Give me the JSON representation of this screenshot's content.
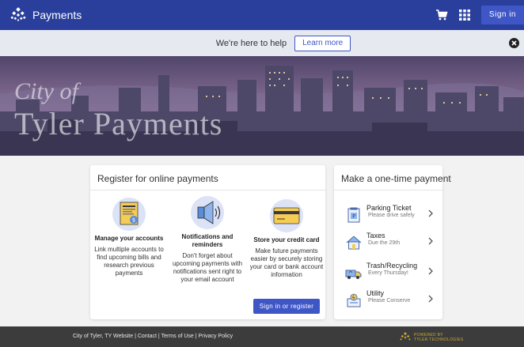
{
  "header": {
    "app_name": "Payments",
    "sign_in_label": "Sign in",
    "brand_color": "#2a3f9b"
  },
  "help_bar": {
    "text": "We're here to help",
    "learn_more_label": "Learn more"
  },
  "hero": {
    "script_text": "City of",
    "title": "Tyler Payments"
  },
  "register_card": {
    "title": "Register for online payments",
    "features": [
      {
        "title": "Manage your accounts",
        "description": "Link multiple accounts to find upcoming bills and research previous payments",
        "icon": "bill-document-icon"
      },
      {
        "title": "Notifications and reminders",
        "description": "Don't forget about upcoming payments with notifications sent right to your email account",
        "icon": "megaphone-icon"
      },
      {
        "title": "Store your credit card",
        "description": "Make future payments easier by securely storing your card or bank account information",
        "icon": "credit-card-icon"
      }
    ],
    "button_label": "Sign in or register"
  },
  "onetime_card": {
    "title": "Make a one-time payment",
    "items": [
      {
        "title": "Parking Ticket",
        "subtitle": "Please drive safely",
        "icon": "parking-ticket-icon"
      },
      {
        "title": "Taxes",
        "subtitle": "Due the 29th",
        "icon": "house-icon"
      },
      {
        "title": "Trash/Recycling",
        "subtitle": "Every Thursday!",
        "icon": "recycling-truck-icon"
      },
      {
        "title": "Utility",
        "subtitle": "Please Conserve",
        "icon": "utility-icon"
      }
    ]
  },
  "footer": {
    "links": [
      "City of Tyler, TY Website",
      "Contact",
      "Terms of Use",
      "Privacy Policy"
    ],
    "powered_by_line1": "POWERED BY",
    "powered_by_line2": "TYLER TECHNOLOGIES"
  }
}
